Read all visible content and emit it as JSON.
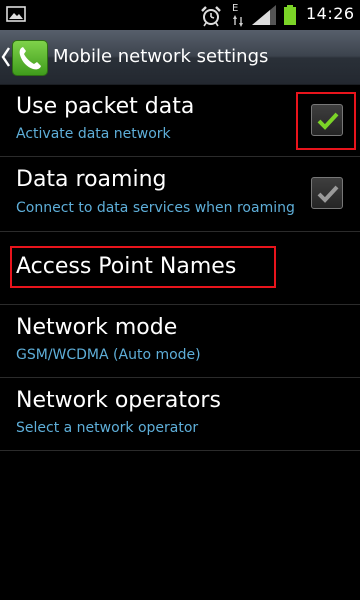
{
  "status_bar": {
    "time": "14:26",
    "network_type": "E",
    "icons": [
      "gallery-icon",
      "alarm-icon",
      "data-arrows-icon",
      "signal-icon",
      "battery-icon"
    ]
  },
  "action_bar": {
    "title": "Mobile network settings",
    "icon": "phone-icon"
  },
  "settings": [
    {
      "title": "Use packet data",
      "subtitle": "Activate data network",
      "checkbox": true,
      "checked": true,
      "check_color": "#7bd427"
    },
    {
      "title": "Data roaming",
      "subtitle": "Connect to data services when roaming",
      "checkbox": true,
      "checked": true,
      "check_color": "#9a9a9a"
    },
    {
      "title": "Access Point Names"
    },
    {
      "title": "Network mode",
      "subtitle": "GSM/WCDMA (Auto mode)"
    },
    {
      "title": "Network operators",
      "subtitle": "Select a network operator"
    }
  ],
  "colors": {
    "subtitle": "#5eaed8",
    "highlight": "#e8141c",
    "battery": "#7bd427"
  }
}
